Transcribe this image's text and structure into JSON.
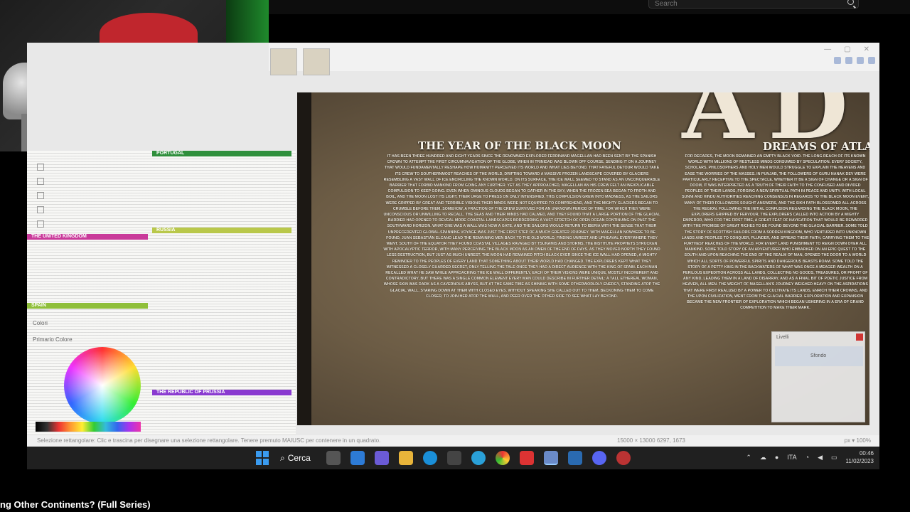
{
  "search": {
    "placeholder": "Search"
  },
  "editor": {
    "map_title_partial": "AD",
    "left_title": "THE YEAR OF THE BLACK MOON",
    "left_body": "It has been three hundred and eight years since the renowned explorer Ferdinand Magellan had been sent by the Spanish crown to attempt the first circumnavigation of the globe, when in Trinidad was blown off course, sending it on a journey that would fundamentally reshape how humanity perceived its world and what lies beyond. That fateful detour would take its crew to southernmost reaches of the world, drifting toward a massive frozen landscape covered by glaciers resembling a vast wall of ice encircling the known world. On its surface, the ice wall seemed to stand as an unconquerable barrier that forbid mankind from going any further. Yet as they approached, Magellan an his crew felt an inexplicable compulsion to keep going. Even when ominous clouds began to gather in the sky, when the frozen sea began to froth and boil, and the moon lost its light, their urge to press on only intensified. This compulsion grew into madness, as the sailors were gripped by great and terrible visions their minds were not equipped to comprehend, and the mighty glaciers began to crumble before them. Somehow, a fraction of the crew survived for an unknown period of time, for which they were unconscious or unwilling to recall. The seas and their minds had calmed, and they found that a large portion of the glacial barrier had opened to reveal more coastal landscapes borderding a vast stretch of open ocean continuing on past the southward horizon. What one was a wall was now a gate, and the sailors would return to Iberia with the sense that their unprecedented global-spanning voyage was just the first step of a much greater journey. With Magellan nowhere to be found, Juan Sebastián Elcano lead the remaining men back to the old world, finding unrest and upheaval everywhere they went. South of the equator they found coastal villages ravaged by tsunamis and storms, the Institute prophets strucken with apocalyptic terror, with many perceiving the black moon as an omen of the end of days. As they moved north they found less destruction, but just as much unrest. The moon had remained pitch black ever since the ice wall had opened, a mighty reminder to the peoples of every land that something about their world had changed. The explorers kept what they witnessed a closely guarded secret, only telling the tale once they had a direct audience with the King of Spain. Each man recalled what he saw while approaching the ice wall differently, each of their visions were unique, mostly incoherent and contradictory, but there was a single common element every man could describe in further detail: A tall ethereal woman, whose skin was dark as a cavernous abyss, but at the same time as shining with some otherworldly energy, standing atop the glacial wall, staring down at them with closed eyes. Without speaking she called out to them, beckoning them to come closer, to join her atop the wall, and peer over the other side to see what lay beyond.",
    "right_title": "DREAMS OF ATLAS",
    "right_body": "For decades, the moon remained an empty black void. The long reach of its known world with millions of restless minds consumed by speculation. Every society, scholars, philosophers and holy men would struggle to explain the heavens and ease the worries of the masses. In Punjab, the followers of Guru Nanak Dev were particularly receptive to the spectacle. Whether it be a sign of change or a sign of doom, it was interpreted as a truth of their faith to the confused and divided peoples of their lands, forging a new spiritual path in peace and unity. With local Sunni and Hindu authorities reaching consensus in regards to the black moon event, many of their followers sought answers, and the Sikh path blossomed all across the region. Following the initial confusion regarding the black moon, the explorers gripped by fervour, the explorers called into action by a mighty emperor, who for the first time, a great feat of navigation that would be rewarded with the promise of great riches to be found beyond the glacial barrier. Some told the story of Scottish sailors from a sodden kingdom, who ventured into unknown lands and peoples to conquer, plunder, and spread their faith, carrying them to the furthest reaches of the world, for every land punishment to reign down over all mankind. Some told story of an adventurer who embarked on an epic quest to the south and upon reaching the end of the realm of man, opened the door to a world which all sorts of powerful spirits and dangerous beasts roam. Some told the story of a petty king in the backwaters of what was once a meager wealth on a perilous expedition across all lands, collecting no goods, treasures, or profit of any kind, leading them in a land of disarray, and as a final bit of poetic justice from heaven, all men. The weight of Magellan's journey weighed heavy on the aspirations that were first realized by a power to cultivate its lands, enrich their crowns, and the upon civilization, went from the glacial barrier. Exploration and expansion became the new frontier of exploration which began ushering in a era of grand competition to make their mark.",
    "popup_label": "Livelli",
    "popup_layer": "Sfondo",
    "color_label": "Colori",
    "color_tabs": "Primario        Colore",
    "status_text": "Selezione rettangolare: Clic e trascina per disegnare una selezione rettangolare. Tenere premuto MAIUSC per contenere in un quadrato.",
    "coords": "15000 × 13000     6297, 1673",
    "zoom": "px    ▾    100%",
    "doc_bands": [
      {
        "label": "PORTUGAL",
        "color": "#2f8f3c"
      },
      {
        "label": "THE UNITED KINGDOM",
        "color": "#c93a9a"
      },
      {
        "label": "RUSSIA",
        "color": "#b9c84a"
      },
      {
        "label": "SPAIN",
        "color": "#8fbf3a"
      },
      {
        "label": "THE REPUBLIC OF PRUSSIA",
        "color": "#8a3ad0"
      }
    ]
  },
  "taskbar": {
    "search_label": "Cerca",
    "lang": "ITA",
    "time": "00:46",
    "date": "11/02/2023"
  },
  "caption": "ng Other Continents? (Full Series)"
}
